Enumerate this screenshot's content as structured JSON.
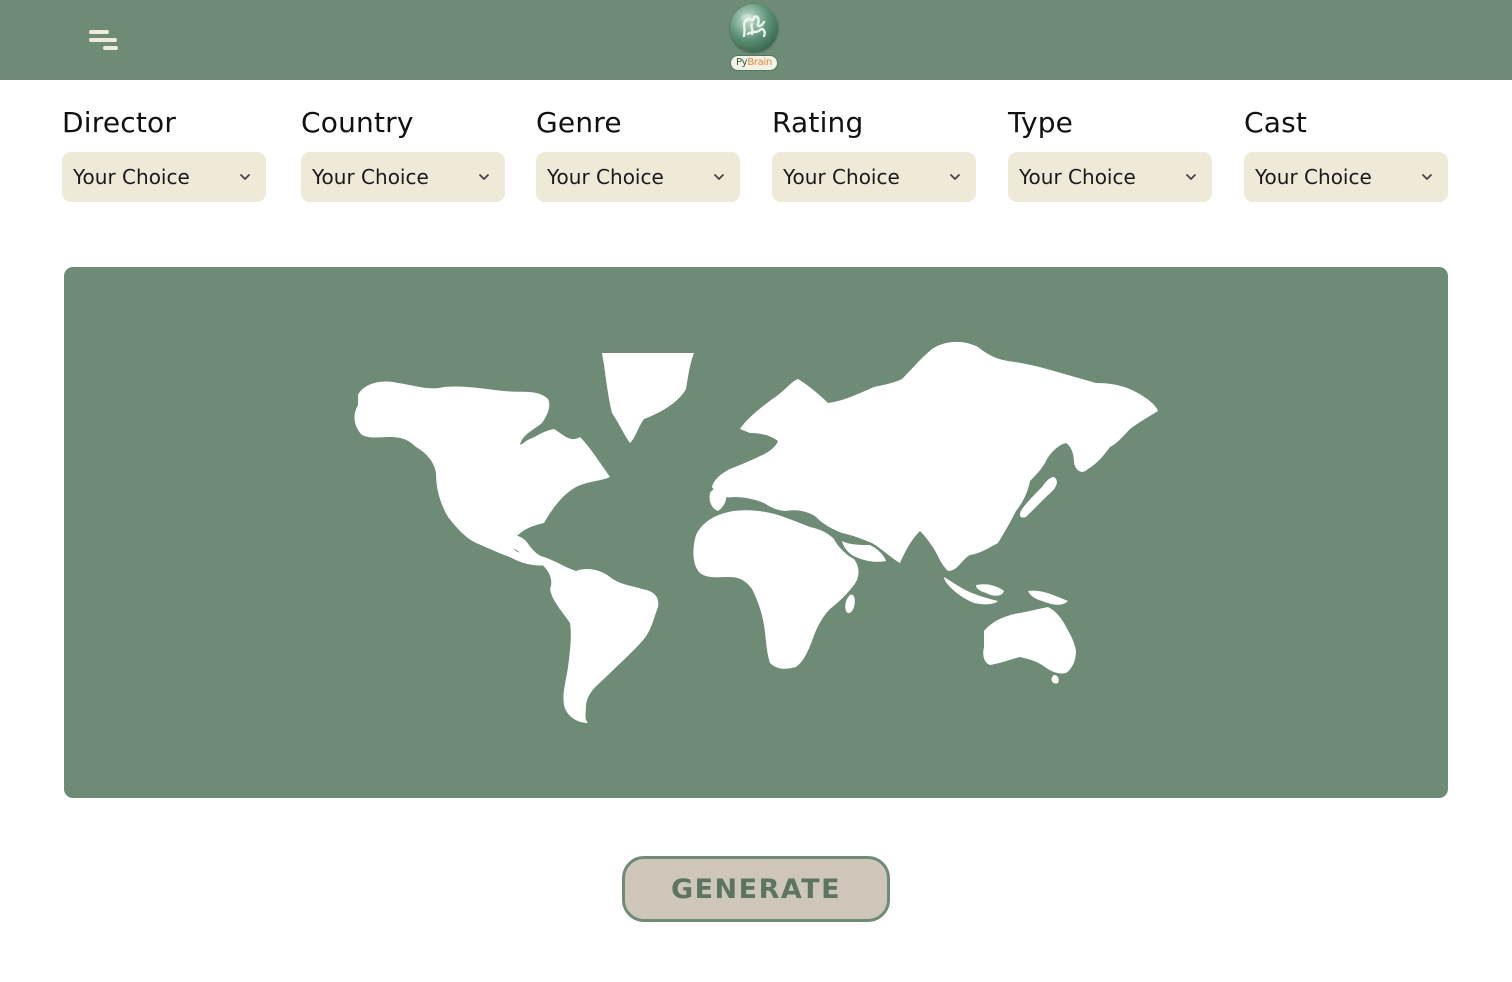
{
  "header": {
    "menu_icon": "hamburger-menu-icon",
    "logo": {
      "text_py": "Py",
      "text_brain": "Brain",
      "accent": "#e08a3c"
    }
  },
  "filters": [
    {
      "label": "Director",
      "value": "Your Choice"
    },
    {
      "label": "Country",
      "value": "Your Choice"
    },
    {
      "label": "Genre",
      "value": "Your Choice"
    },
    {
      "label": "Rating",
      "value": "Your Choice"
    },
    {
      "label": "Type",
      "value": "Your Choice"
    },
    {
      "label": "Cast",
      "value": "Your Choice"
    }
  ],
  "map": {
    "icon": "world-map-icon"
  },
  "actions": {
    "generate_label": "GENERATE"
  },
  "colors": {
    "header_bg": "#6d8b75",
    "select_bg": "#efe9d8",
    "button_bg": "#cfc6ba",
    "button_text": "#5b7562",
    "continent_fill": "#ffffff"
  }
}
